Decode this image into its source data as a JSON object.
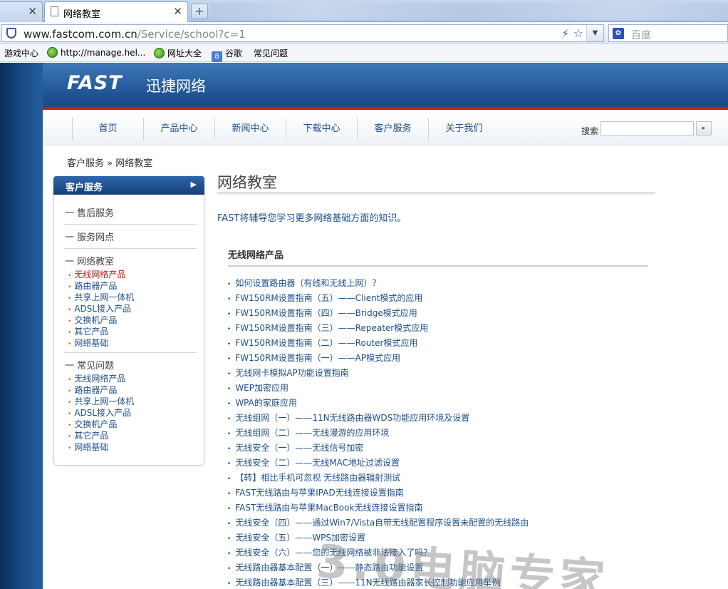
{
  "browser": {
    "tab_title": "网络教室",
    "new_tab": "+",
    "url_domain": "www.fastcom.com.cn",
    "url_path": "/Service/school?c=1",
    "search_placeholder": "百度",
    "bookmarks": [
      {
        "label": "游戏中心",
        "icon": "none"
      },
      {
        "label": "http://manage.hel...",
        "icon": "green-globe"
      },
      {
        "label": "网址大全",
        "icon": "green-globe"
      },
      {
        "label": "谷歌",
        "icon": "google"
      },
      {
        "label": "常见问题",
        "icon": "page"
      }
    ]
  },
  "site": {
    "logo": "FAST",
    "logo_cn": "迅捷网络",
    "nav": [
      "首页",
      "产品中心",
      "新闻中心",
      "下载中心",
      "客户服务",
      "关于我们"
    ],
    "search_label": "搜索"
  },
  "breadcrumb": "客户服务 » 网络教室",
  "sidebar": {
    "title": "客户服务",
    "sections": [
      {
        "label": "售后服务"
      },
      {
        "label": "服务网点"
      },
      {
        "label": "网络教室",
        "items": [
          "无线网络产品",
          "路由器产品",
          "共享上网一体机",
          "ADSL接入产品",
          "交换机产品",
          "其它产品",
          "网络基础"
        ]
      },
      {
        "label": "常见问题",
        "items": [
          "无线网络产品",
          "路由器产品",
          "共享上网一体机",
          "ADSL接入产品",
          "交换机产品",
          "其它产品",
          "网络基础"
        ]
      }
    ]
  },
  "main": {
    "title": "网络教室",
    "intro": "FAST将辅导您学习更多网络基础方面的知识。",
    "section_title": "无线网络产品",
    "articles": [
      "如何设置路由器（有线和无线上网）？",
      "FW150RM设置指南（五）——Client模式的应用",
      "FW150RM设置指南（四）——Bridge模式应用",
      "FW150RM设置指南（三）——Repeater模式应用",
      "FW150RM设置指南（二）——Router模式应用",
      "FW150RM设置指南（一）——AP模式应用",
      "无线网卡模拟AP功能设置指南",
      "WEP加密应用",
      "WPA的家庭应用",
      "无线组网（一）——11N无线路由器WDS功能应用环境及设置",
      "无线组网（二）——无线漫游的应用环境",
      "无线安全（一）——无线信号加密",
      "无线安全（二）——无线MAC地址过滤设置",
      "【转】相比手机可忽视 无线路由器辐射测试",
      "FAST无线路由与苹果IPAD无线连接设置指南",
      "FAST无线路由与苹果MacBook无线连接设置指南",
      "无线安全（四）——通过Win7/Vista自带无线配置程序设置未配置的无线路由",
      "无线安全（五）——WPS加密设置",
      "无线安全（六）——您的无线网络被非法接入了吗？",
      "无线路由器基本配置（一）——静态路由功能设置",
      "无线路由器基本配置（三）——11N无线路由器家长控制功能应用举例"
    ]
  },
  "watermark": "3.0电脑专家"
}
